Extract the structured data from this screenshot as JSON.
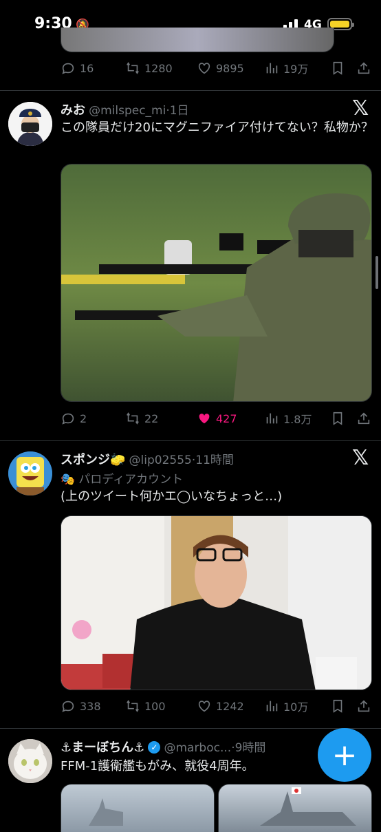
{
  "status_bar": {
    "time": "9:30",
    "network": "4G",
    "battery_color": "#f5d327"
  },
  "tweets": [
    {
      "stats": {
        "replies": "16",
        "retweets": "1280",
        "likes": "9895",
        "views": "19万"
      }
    },
    {
      "name": "みお",
      "handle": "@milspec_mi",
      "time": "·1日",
      "text": "この隊員だけ20にマグニファイア付けてない？私物か？",
      "stats": {
        "replies": "2",
        "retweets": "22",
        "likes": "427",
        "views": "1.8万"
      },
      "liked": true
    },
    {
      "name": "スポンジ🧽",
      "handle": "@lip02555",
      "time": "·11時間",
      "label": "パロディアカウント",
      "text": "(上のツイート何かエ◯いなちょっと…)",
      "stats": {
        "replies": "338",
        "retweets": "100",
        "likes": "1242",
        "views": "10万"
      }
    },
    {
      "name": "⚓まーぼちん⚓",
      "handle": "@marboc...",
      "time": "·9時間",
      "text": "FFM-1護衛艦もがみ、就役4周年。"
    }
  ],
  "fab": {
    "label": "+"
  },
  "colors": {
    "like_active": "#f91880",
    "accent": "#1d9bf0"
  }
}
